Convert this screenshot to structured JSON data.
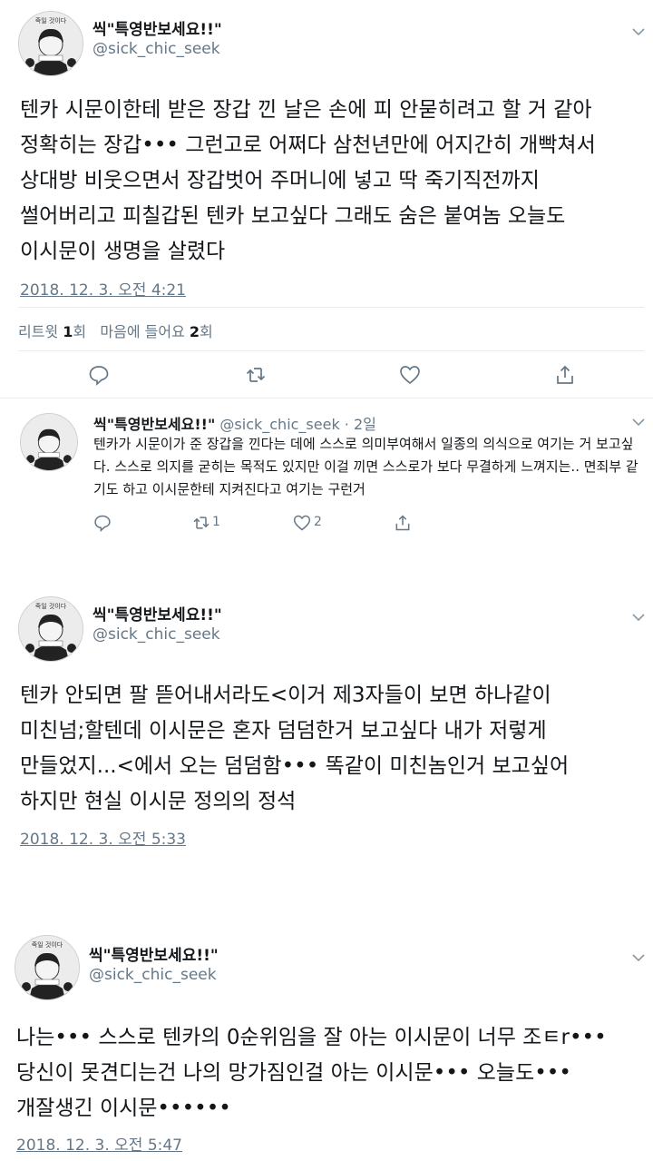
{
  "user": {
    "name": "씩\"특영반보세요!!\"",
    "handle": "@sick_chic_seek",
    "avatar_caption": "죽일 것이다"
  },
  "tweet1": {
    "text": "텐카 시문이한테 받은 장갑 낀 날은 손에 피 안묻히려고 할 거 같아\n정확히는 장갑••• 그런고로 어쩌다 삼천년만에 어지간히 개빡쳐서\n상대방 비웃으면서 장갑벗어 주머니에 넣고 딱 죽기직전까지\n썰어버리고 피칠갑된 텐카 보고싶다 그래도 숨은 붙여놈 오늘도\n이시문이 생명을 살렸다",
    "timestamp": "2018. 12. 3. 오전 4:21",
    "stats": {
      "retweet_label": "리트윗",
      "retweet_count": "1",
      "retweet_unit": "회",
      "like_label": "마음에 들어요",
      "like_count": "2",
      "like_unit": "회"
    }
  },
  "reply": {
    "name": "씩\"특영반보세요!!\"",
    "handle_time": "@sick_chic_seek · 2일",
    "text": "텐카가 시문이가 준 장갑을 낀다는 데에 스스로 의미부여해서 일종의 의식으로 여기는 거 보고싶다. 스스로 의지를 굳히는 목적도 있지만 이걸 끼면 스스로가 보다 무결하게 느껴지는.. 면죄부 같기도 하고 이시문한테 지켜진다고 여기는 구런거",
    "retweet_count": "1",
    "like_count": "2"
  },
  "tweet2": {
    "text": "텐카 안되면 팔 뜯어내서라도<이거 제3자들이 보면 하나같이\n미친넘;할텐데 이시문은 혼자 덤덤한거 보고싶다 내가 저렇게\n만들었지...<에서 오는 덤덤함••• 똑같이 미친놈인거 보고싶어\n하지만 현실 이시문 정의의 정석",
    "timestamp": "2018. 12. 3. 오전 5:33"
  },
  "tweet3": {
    "text": "나는••• 스스로 텐카의 0순위임을 잘 아는 이시문이 너무 조ㅌr•••\n당신이 못견디는건 나의 망가짐인걸 아는 이시문••• 오늘도•••\n개잘생긴 이시문••••••",
    "timestamp": "2018. 12. 3. 오전 5:47"
  },
  "colors": {
    "text": "#14171a",
    "secondary": "#657786",
    "divider": "#e6ecf0"
  }
}
